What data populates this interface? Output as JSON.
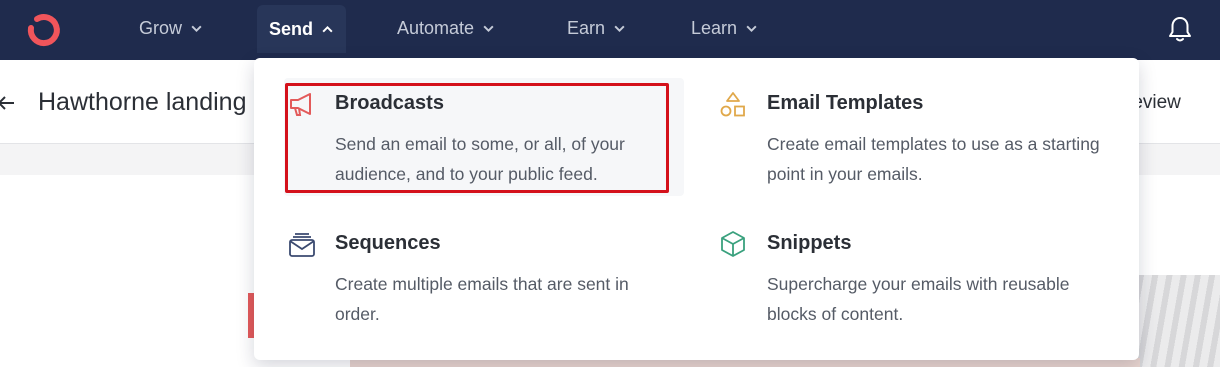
{
  "nav": {
    "items": [
      {
        "label": "Grow"
      },
      {
        "label": "Send"
      },
      {
        "label": "Automate"
      },
      {
        "label": "Earn"
      },
      {
        "label": "Learn"
      }
    ],
    "active": "Send"
  },
  "page": {
    "title": "Hawthorne landing",
    "preview_label": "review"
  },
  "dropdown": {
    "items": [
      {
        "title": "Broadcasts",
        "description": "Send an email to some, or all, of your audience, and to your public feed.",
        "icon": "megaphone-icon",
        "icon_color": "#e35a5a"
      },
      {
        "title": "Email Templates",
        "description": "Create email templates to use as a starting point in your emails.",
        "icon": "shapes-icon",
        "icon_color": "#e0a84a"
      },
      {
        "title": "Sequences",
        "description": "Create multiple emails that are sent in order.",
        "icon": "envelope-stack-icon",
        "icon_color": "#3b4a70"
      },
      {
        "title": "Snippets",
        "description": "Supercharge your emails with reusable blocks of content.",
        "icon": "cube-icon",
        "icon_color": "#3aa17e"
      }
    ]
  },
  "colors": {
    "nav_bg": "#1f2b4d",
    "brand": "#e35a5a",
    "highlight_box": "#d4111b"
  }
}
